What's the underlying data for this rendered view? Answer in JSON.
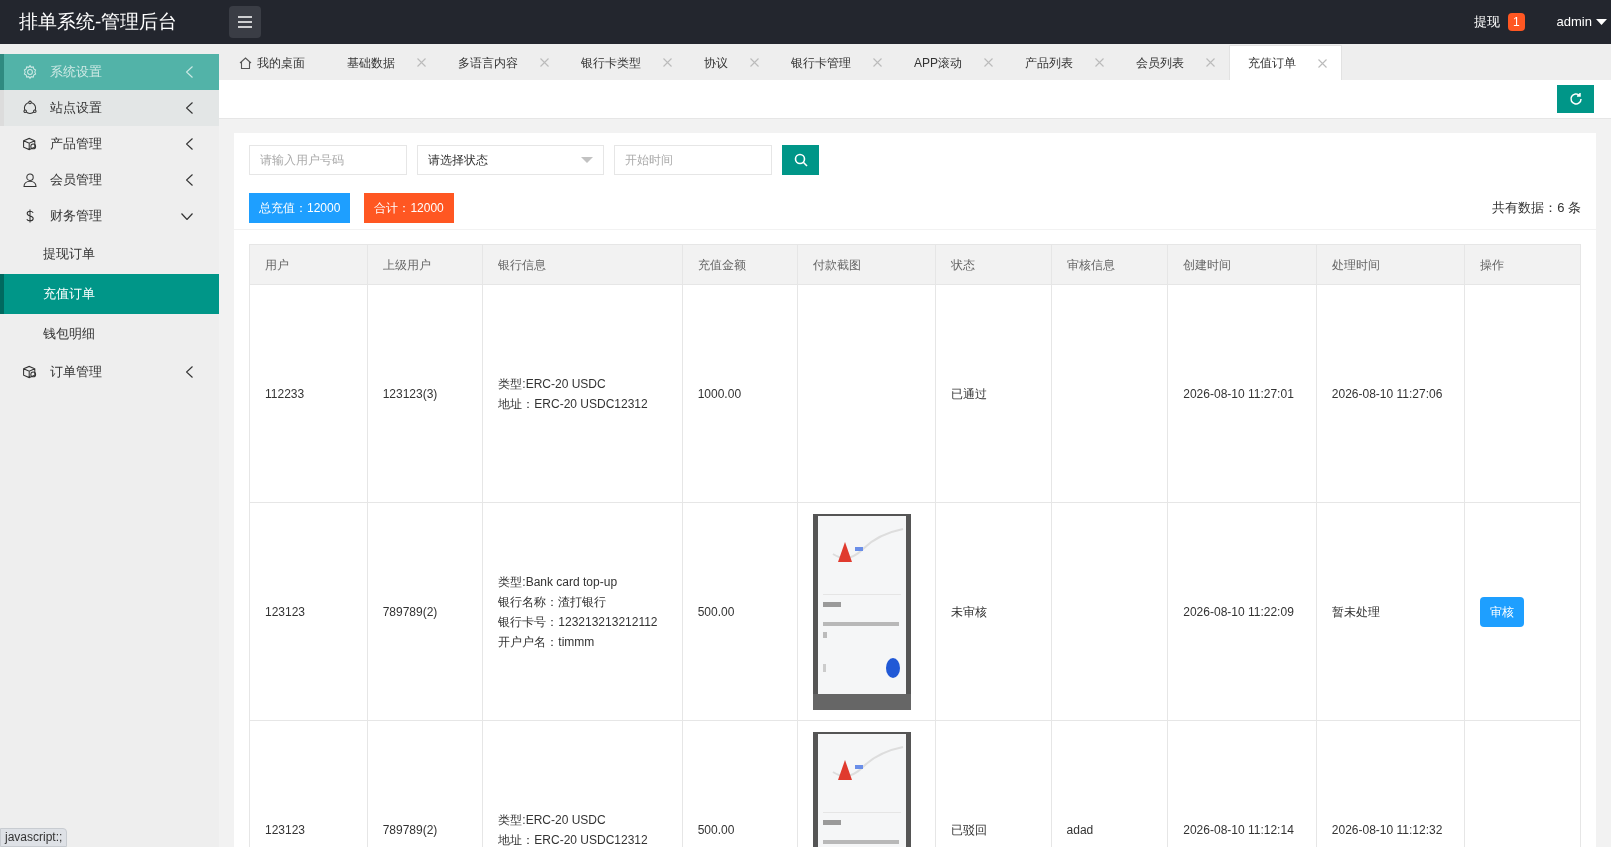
{
  "header": {
    "title": "排单系统-管理后台",
    "withdraw": {
      "label": "提现",
      "badge": "1"
    },
    "user": "admin"
  },
  "sidebar": {
    "items": [
      {
        "label": "系统设置",
        "expanded": false,
        "hovered": true,
        "focused": false
      },
      {
        "label": "站点设置",
        "expanded": false,
        "hovered": false,
        "focused": true
      },
      {
        "label": "产品管理",
        "expanded": false,
        "hovered": false,
        "focused": false
      },
      {
        "label": "会员管理",
        "expanded": false,
        "hovered": false,
        "focused": false
      },
      {
        "label": "财务管理",
        "expanded": true,
        "hovered": false,
        "focused": false,
        "children": [
          {
            "label": "提现订单",
            "selected": false
          },
          {
            "label": "充值订单",
            "selected": true
          },
          {
            "label": "钱包明细",
            "selected": false
          }
        ]
      },
      {
        "label": "订单管理",
        "expanded": false,
        "hovered": false,
        "focused": false
      }
    ]
  },
  "tabs": [
    {
      "kind": "home",
      "label": "我的桌面",
      "selected": false
    },
    {
      "kind": "closable",
      "label": "基础数据",
      "selected": false
    },
    {
      "kind": "closable",
      "label": "多语言内容",
      "selected": false
    },
    {
      "kind": "closable",
      "label": "银行卡类型",
      "selected": false
    },
    {
      "kind": "closable",
      "label": "协议",
      "selected": false
    },
    {
      "kind": "closable",
      "label": "银行卡管理",
      "selected": false
    },
    {
      "kind": "closable",
      "label": "APP滚动",
      "selected": false
    },
    {
      "kind": "closable",
      "label": "产品列表",
      "selected": false
    },
    {
      "kind": "closable",
      "label": "会员列表",
      "selected": false
    },
    {
      "kind": "closable",
      "label": "充值订单",
      "selected": true
    }
  ],
  "filters": {
    "user_placeholder": "请输入用户号码",
    "status_select": "请选择状态",
    "start_placeholder": "开始时间"
  },
  "totals": [
    {
      "label": "总充值：12000",
      "color": "#1e9fff"
    },
    {
      "label": "合计：12000",
      "color": "#ff5722"
    }
  ],
  "record_count": "共有数据：6 条",
  "table": {
    "columns": [
      "用户",
      "上级用户",
      "银行信息",
      "充值金额",
      "付款截图",
      "状态",
      "审核信息",
      "创建时间",
      "处理时间",
      "操作"
    ],
    "rows": [
      {
        "user": "112233",
        "parent": "123123(3)",
        "bank_info": [
          "类型:ERC-20 USDC",
          "地址：ERC-20 USDC12312"
        ],
        "amount": "1000.00",
        "status": "已通过",
        "created": "2026-08-10 11:27:01",
        "processed": "2026-08-10 11:27:06"
      },
      {
        "user": "123123",
        "parent": "789789(2)",
        "bank_info": [
          "类型:Bank card top-up",
          "银行名称：渣打银行",
          "银行卡号：123213213212112",
          "开户户名：timmm"
        ],
        "amount": "500.00",
        "screenshot": {
          "kind": "picture"
        },
        "status": "未审核",
        "created": "2026-08-10 11:22:09",
        "processed": "暂未处理",
        "action": "审核"
      },
      {
        "user": "123123",
        "parent": "789789(2)",
        "bank_info": [
          "类型:ERC-20 USDC",
          "地址：ERC-20 USDC12312"
        ],
        "amount": "500.00",
        "screenshot": {
          "kind": "picture"
        },
        "status": "已驳回",
        "review": "adad",
        "created": "2026-08-10 11:12:14",
        "processed": "2026-08-10 11:12:32"
      }
    ]
  },
  "status_bar": "javascript:;"
}
